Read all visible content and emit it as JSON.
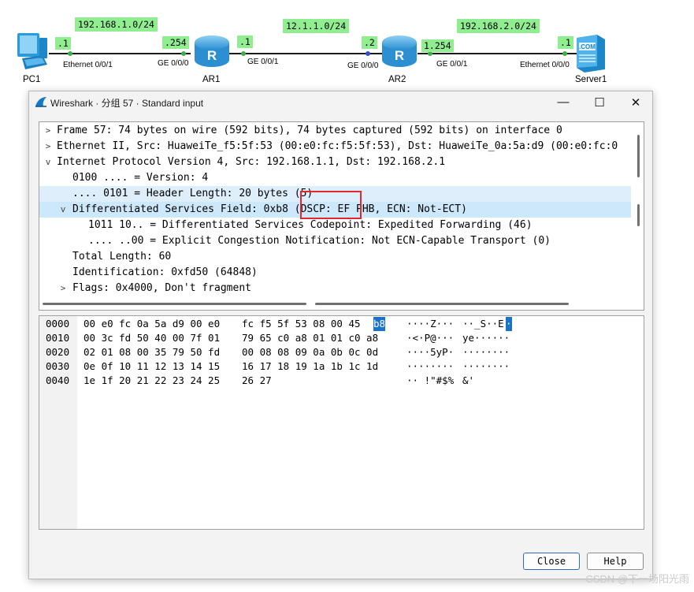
{
  "topology": {
    "networks": [
      "192.168.1.0/24",
      "12.1.1.0/24",
      "192.168.2.0/24"
    ],
    "devices": {
      "pc1": "PC1",
      "ar1": "AR1",
      "ar2": "AR2",
      "server1": "Server1"
    },
    "ip_suffixes": {
      "pc1": ".1",
      "ar1_left": ".254",
      "ar1_right": ".1",
      "ar2_left": ".2",
      "ar2_right": "1.254",
      "server1": ".1"
    },
    "ports": {
      "pc1": "Ethernet 0/0/1",
      "ar1_left": "GE 0/0/0",
      "ar1_right": "GE 0/0/1",
      "ar2_left": "GE 0/0/0",
      "ar2_right": "GE 0/0/1",
      "server1": "Ethernet 0/0/0"
    },
    "server_icon_text": ".COM",
    "router_icon_text": "R"
  },
  "window": {
    "title": "Wireshark · 分组 57 · Standard input",
    "controls": {
      "minimize": "—",
      "maximize": "☐",
      "close": "✕"
    }
  },
  "tree": [
    {
      "arrow": ">",
      "text": "Frame 57: 74 bytes on wire (592 bits), 74 bytes captured (592 bits) on interface 0"
    },
    {
      "arrow": ">",
      "text": "Ethernet II, Src: HuaweiTe_f5:5f:53 (00:e0:fc:f5:5f:53), Dst: HuaweiTe_0a:5a:d9 (00:e0:fc:0"
    },
    {
      "arrow": "v",
      "text": "Internet Protocol Version 4, Src: 192.168.1.1, Dst: 192.168.2.1"
    },
    {
      "arrow": "",
      "text": "0100 .... = Version: 4"
    },
    {
      "arrow": "",
      "text": ".... 0101 = Header Length: 20 bytes (5)"
    },
    {
      "arrow": "v",
      "text": "Differentiated Services Field: 0xb8 (DSCP: EF PHB, ECN: Not-ECT)"
    },
    {
      "arrow": "",
      "text": "1011 10.. = Differentiated Services Codepoint: Expedited Forwarding (46)"
    },
    {
      "arrow": "",
      "text": ".... ..00 = Explicit Congestion Notification: Not ECN-Capable Transport (0)"
    },
    {
      "arrow": "",
      "text": "Total Length: 60"
    },
    {
      "arrow": "",
      "text": "Identification: 0xfd50 (64848)"
    },
    {
      "arrow": ">",
      "text": "Flags: 0x4000, Don't fragment"
    }
  ],
  "hex": [
    {
      "offset": "0000",
      "bytes_a": "00 e0 fc 0a 5a d9 00 e0",
      "bytes_b": "fc f5 5f 53 08 00 45",
      "sel_byte": "b8",
      "ascii_a": "····Z···",
      "ascii_b": "··_S··E",
      "sel_ascii": "·"
    },
    {
      "offset": "0010",
      "bytes_a": "00 3c fd 50 40 00 7f 01",
      "bytes_b": "79 65 c0 a8 01 01 c0 a8",
      "sel_byte": "",
      "ascii_a": "·<·P@···",
      "ascii_b": "ye······",
      "sel_ascii": ""
    },
    {
      "offset": "0020",
      "bytes_a": "02 01 08 00 35 79 50 fd",
      "bytes_b": "00 08 08 09 0a 0b 0c 0d",
      "sel_byte": "",
      "ascii_a": "····5yP·",
      "ascii_b": "········",
      "sel_ascii": ""
    },
    {
      "offset": "0030",
      "bytes_a": "0e 0f 10 11 12 13 14 15",
      "bytes_b": "16 17 18 19 1a 1b 1c 1d",
      "sel_byte": "",
      "ascii_a": "········",
      "ascii_b": "········",
      "sel_ascii": ""
    },
    {
      "offset": "0040",
      "bytes_a": "1e 1f 20 21 22 23 24 25",
      "bytes_b": "26 27",
      "sel_byte": "",
      "ascii_a": "·· !\"#$%",
      "ascii_b": "&'",
      "sel_ascii": ""
    }
  ],
  "buttons": {
    "close": "Close",
    "help": "Help"
  },
  "watermark": "CSDN @下一场阳光雨",
  "colors": {
    "net_label_bg": "#90ee90",
    "selection": "#1a73c7",
    "highlight_box": "#e0282e",
    "row_highlight": "#dfeefb"
  }
}
